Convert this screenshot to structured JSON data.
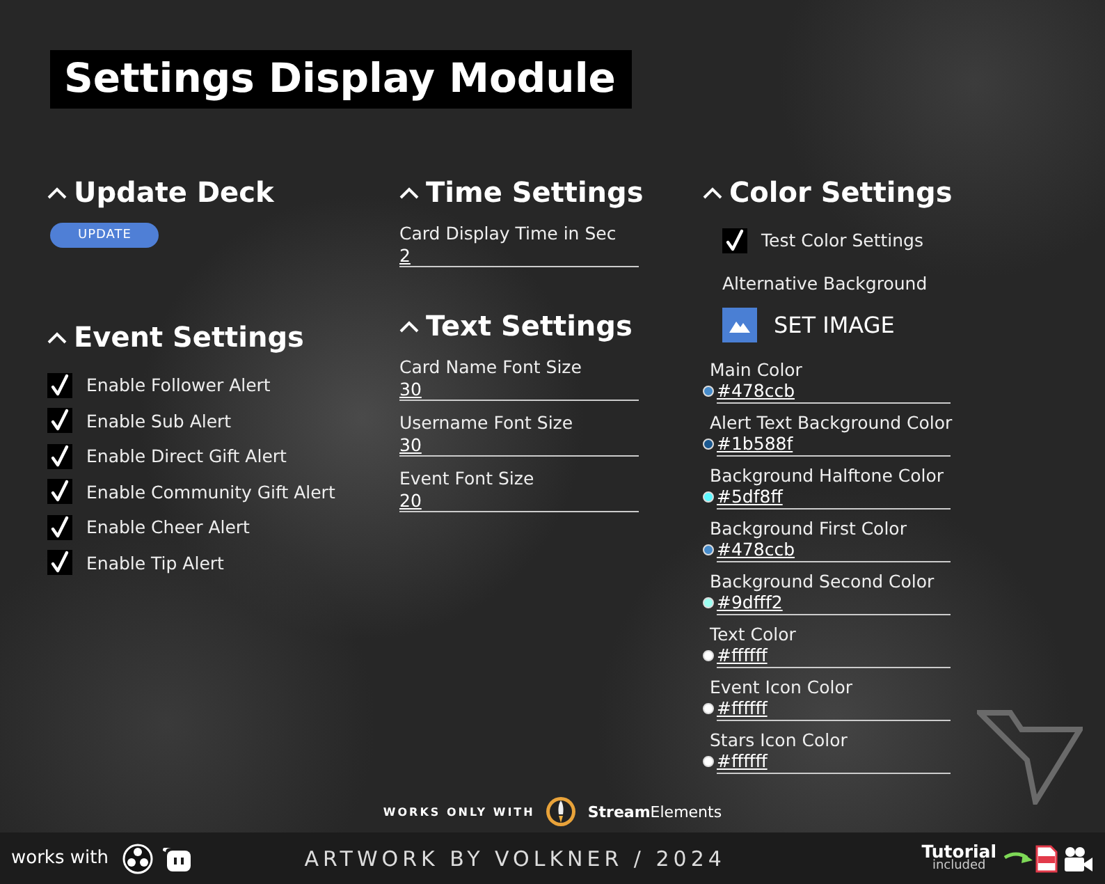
{
  "title": "Settings Display Module",
  "columns": [
    {
      "sections": [
        {
          "heading": "Update Deck",
          "items": [
            {
              "kind": "button",
              "label": "UPDATE"
            }
          ]
        },
        {
          "heading": "Event Settings",
          "items": [
            {
              "kind": "checkbox",
              "label": "Enable Follower Alert",
              "checked": true
            },
            {
              "kind": "checkbox",
              "label": "Enable Sub Alert",
              "checked": true
            },
            {
              "kind": "checkbox",
              "label": "Enable Direct Gift Alert",
              "checked": true
            },
            {
              "kind": "checkbox",
              "label": "Enable Community Gift Alert",
              "checked": true
            },
            {
              "kind": "checkbox",
              "label": "Enable Cheer Alert",
              "checked": true
            },
            {
              "kind": "checkbox",
              "label": "Enable Tip Alert",
              "checked": true
            }
          ]
        }
      ]
    },
    {
      "sections": [
        {
          "heading": "Time Settings",
          "items": [
            {
              "kind": "field",
              "label": "Card Display Time in Sec",
              "value": "2"
            }
          ]
        },
        {
          "heading": "Text Settings",
          "items": [
            {
              "kind": "field",
              "label": "Card Name Font Size",
              "value": "30"
            },
            {
              "kind": "field",
              "label": "Username Font Size",
              "value": "30"
            },
            {
              "kind": "field",
              "label": "Event Font Size",
              "value": "20"
            }
          ]
        }
      ]
    },
    {
      "sections": [
        {
          "heading": "Color Settings",
          "items": [
            {
              "kind": "checkbox",
              "label": "Test Color Settings",
              "checked": true
            },
            {
              "kind": "label",
              "label": "Alternative Background"
            },
            {
              "kind": "image_button",
              "label": "SET IMAGE"
            },
            {
              "kind": "color_field",
              "label": "Main Color",
              "value": "#478ccb",
              "color": "#478ccb"
            },
            {
              "kind": "color_field",
              "label": "Alert Text Background Color",
              "value": "#1b588f",
              "color": "#1b588f"
            },
            {
              "kind": "color_field",
              "label": "Background Halftone Color",
              "value": "#5df8ff",
              "color": "#5df8ff"
            },
            {
              "kind": "color_field",
              "label": "Background First Color",
              "value": "#478ccb",
              "color": "#478ccb"
            },
            {
              "kind": "color_field",
              "label": "Background Second Color",
              "value": "#9dfff2",
              "color": "#9dfff2"
            },
            {
              "kind": "color_field",
              "label": "Text Color",
              "value": "#ffffff",
              "color": "#ffffff"
            },
            {
              "kind": "color_field",
              "label": "Event Icon Color",
              "value": "#ffffff",
              "color": "#ffffff"
            },
            {
              "kind": "color_field",
              "label": "Stars Icon Color",
              "value": "#ffffff",
              "color": "#ffffff"
            }
          ]
        }
      ]
    }
  ],
  "footer": {
    "works_only_with": "WORKS ONLY WITH",
    "brand": "**Stream**Elements",
    "works_with": "works with",
    "credit": "ARTWORK BY VOLKNER / 2024",
    "tutorial": "Tutorial",
    "tutorial_note": "included"
  }
}
